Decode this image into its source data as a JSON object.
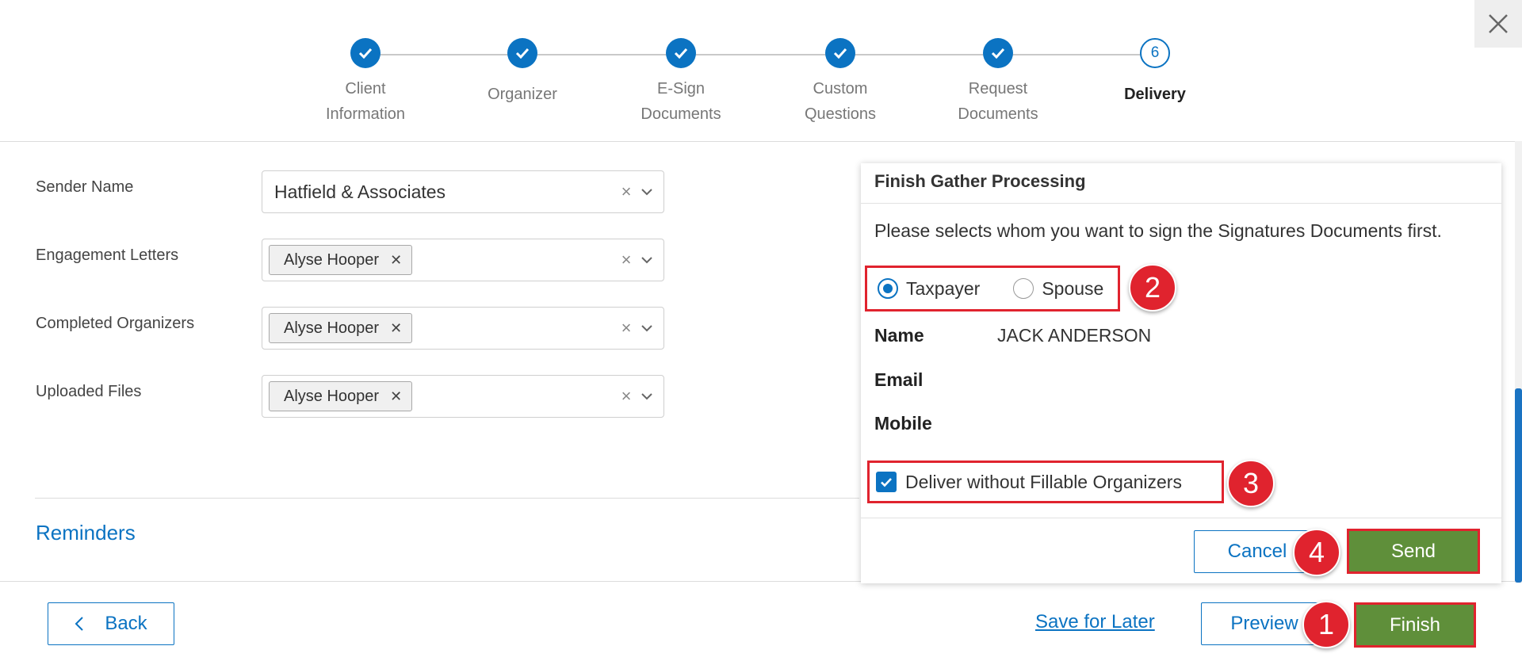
{
  "stepper": {
    "steps": [
      {
        "label": "Client\nInformation",
        "state": "done"
      },
      {
        "label": "Organizer",
        "state": "done"
      },
      {
        "label": "E-Sign\nDocuments",
        "state": "done"
      },
      {
        "label": "Custom\nQuestions",
        "state": "done"
      },
      {
        "label": "Request\nDocuments",
        "state": "done"
      },
      {
        "label": "Delivery",
        "state": "current",
        "number": "6"
      }
    ]
  },
  "form": {
    "sender_name": {
      "label": "Sender Name",
      "value": "Hatfield & Associates"
    },
    "engagement_letters": {
      "label": "Engagement Letters",
      "tag": "Alyse Hooper"
    },
    "completed_organizers": {
      "label": "Completed Organizers",
      "tag": "Alyse Hooper"
    },
    "uploaded_files": {
      "label": "Uploaded Files",
      "tag": "Alyse Hooper"
    },
    "reminders_label": "Reminders"
  },
  "footer": {
    "back_label": "Back",
    "save_later_label": "Save for Later",
    "preview_label": "Preview",
    "finish_label": "Finish"
  },
  "popup": {
    "title": "Finish Gather Processing",
    "message": "Please selects whom you want to sign the Signatures Documents first.",
    "radio_taxpayer": "Taxpayer",
    "radio_spouse": "Spouse",
    "selected_radio": "Taxpayer",
    "name_key": "Name",
    "name_value": "JACK ANDERSON",
    "email_key": "Email",
    "mobile_key": "Mobile",
    "checkbox_label": "Deliver without Fillable Organizers",
    "checkbox_checked": true,
    "cancel_label": "Cancel",
    "send_label": "Send"
  },
  "annotations": {
    "one": "1",
    "two": "2",
    "three": "3",
    "four": "4"
  },
  "colors": {
    "accent": "#0b73c2",
    "finish_green": "#5f8f3a",
    "annotation_red": "#e0232e"
  }
}
